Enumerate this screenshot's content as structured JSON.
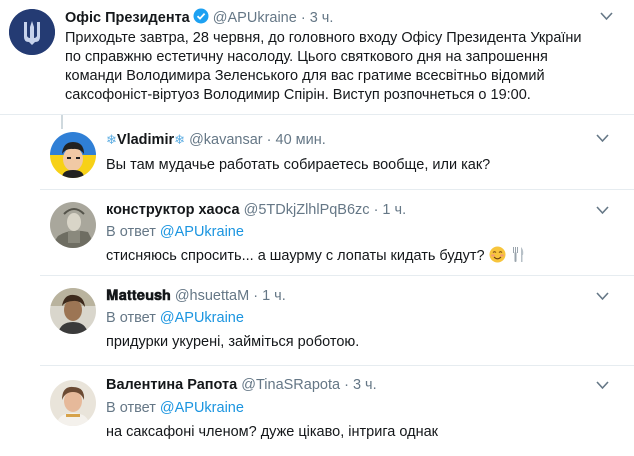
{
  "main": {
    "name": "Офіс Президента",
    "handle": "@APUkraine",
    "time": "· 3 ч.",
    "text_lines": [
      "Приходьте завтра, 28 червня, до головного входу Офісу Президента України",
      "по справжню естетичну насолоду. Цього святкового дня на запрошення",
      "команди Володимира Зеленського для вас гратиме всесвітньо відомий",
      "саксофоніст-віртуоз Володимир Спірін. Виступ розпочнеться о 19:00."
    ]
  },
  "replies": [
    {
      "name": "Vladimir",
      "name_prefix": "❄",
      "name_suffix": "❄",
      "handle": "@kavansar",
      "time": "· 40 мин.",
      "reply_prefix": "",
      "reply_mention": "",
      "text": "Вы там мудачье работать собираетесь вообще, или как?"
    },
    {
      "name": "конструктор хаоса",
      "handle": "@5TDkjZlhlPqB6zc",
      "time": "· 1 ч.",
      "reply_prefix": "В ответ ",
      "reply_mention": "@APUkraine",
      "text": "стисняюсь спросить... а шаурму с лопаты кидать будут?"
    },
    {
      "name": "𝐌𝐚𝐭𝐭𝐞𝐮𝐬𝐡",
      "handle": "@hsuettaM",
      "time": "· 1 ч.",
      "reply_prefix": "В ответ ",
      "reply_mention": "@APUkraine",
      "text": "придурки укурені, займіться роботою."
    },
    {
      "name": "Валентина Рапота",
      "handle": "@TinaSRapota",
      "time": "· 3 ч.",
      "reply_prefix": "В ответ ",
      "reply_mention": "@APUkraine",
      "text": "на саксафоні членом? дуже цікаво, інтрига однак"
    }
  ],
  "icons": {
    "more": "chevron-down-icon",
    "verified": "verified-badge-icon"
  },
  "colors": {
    "link": "#1b95e0",
    "secondary": "#657786",
    "verified": "#1da1f2"
  }
}
